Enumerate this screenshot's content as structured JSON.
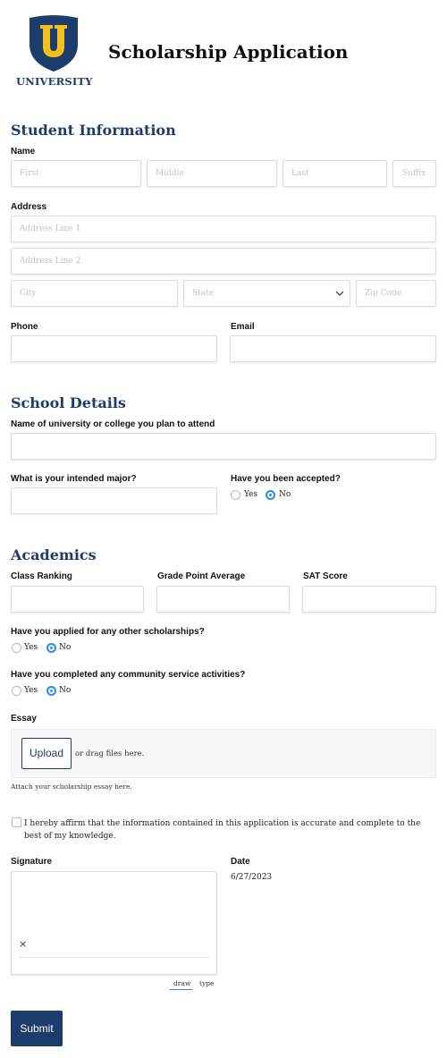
{
  "header": {
    "logo_text": "UNIVERSITY",
    "logo_letter": "U",
    "title": "Scholarship Application"
  },
  "student_info": {
    "title": "Student Information",
    "name_label": "Name",
    "first_placeholder": "First",
    "middle_placeholder": "Middle",
    "last_placeholder": "Last",
    "suffix_placeholder": "Suffix",
    "address_label": "Address",
    "address1_placeholder": "Address Line 1",
    "address2_placeholder": "Address Line 2",
    "city_placeholder": "City",
    "state_placeholder": "State",
    "zip_placeholder": "Zip Code",
    "phone_label": "Phone",
    "email_label": "Email"
  },
  "school": {
    "title": "School Details",
    "university_label": "Name of university or college you plan to attend",
    "major_label": "What is your intended major?",
    "accepted_label": "Have you been accepted?",
    "yes": "Yes",
    "no": "No",
    "accepted_value": "No"
  },
  "academics": {
    "title": "Academics",
    "ranking_label": "Class Ranking",
    "gpa_label": "Grade Point Average",
    "sat_label": "SAT Score",
    "other_scholarships_label": "Have you applied for any other scholarships?",
    "other_scholarships_value": "No",
    "community_label": "Have you completed any community service activities?",
    "community_value": "No",
    "yes": "Yes",
    "no": "No",
    "essay_label": "Essay",
    "upload_label": "Upload",
    "drag_text": "or drag files here.",
    "essay_help": "Attach your scholarship essay here."
  },
  "affirm": {
    "text": "I hereby affirm that the information contained in this application is accurate and complete to the best of my knowledge.",
    "checked": false
  },
  "signature": {
    "label": "Signature",
    "clear_symbol": "×",
    "tab_draw": "draw",
    "tab_type": "type",
    "active_tab": "draw"
  },
  "date": {
    "label": "Date",
    "value": "6/27/2023"
  },
  "submit_label": "Submit",
  "colors": {
    "brand_navy": "#1c3d6b",
    "brand_gold": "#f2c01e",
    "radio_active": "#2a8ef0"
  }
}
